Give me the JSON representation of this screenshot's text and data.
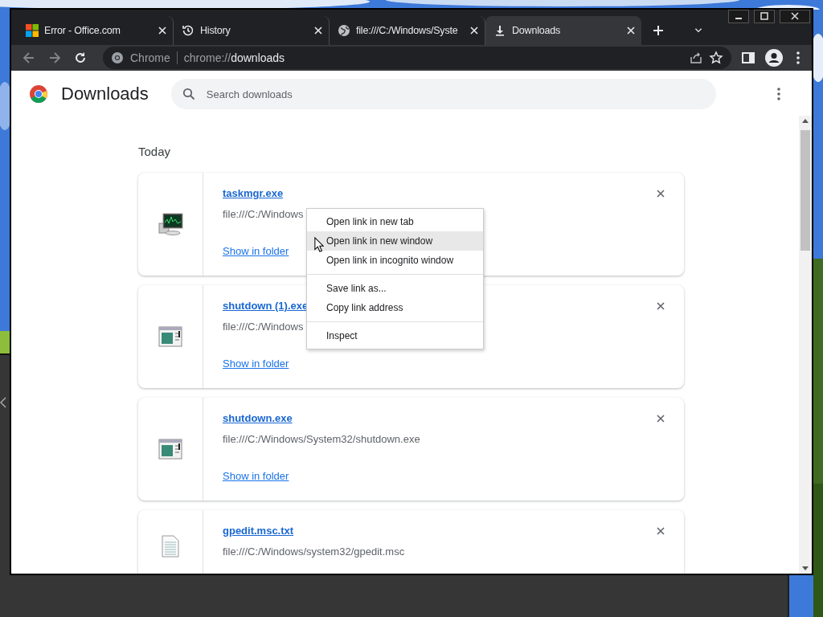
{
  "tabs": [
    {
      "title": "Error - Office.com",
      "selected": false
    },
    {
      "title": "History",
      "selected": false
    },
    {
      "title": "file:///C:/Windows/Syste",
      "selected": false
    },
    {
      "title": "Downloads",
      "selected": true
    }
  ],
  "address_bar": {
    "chip": "Chrome",
    "url_prefix": "chrome://",
    "url_host": "downloads"
  },
  "page": {
    "title": "Downloads",
    "search": {
      "placeholder": "Search downloads"
    },
    "section": "Today"
  },
  "downloads": [
    {
      "name": "taskmgr.exe",
      "path": "file:///C:/Windows",
      "action": "Show in folder"
    },
    {
      "name": "shutdown (1).exe",
      "path": "file:///C:/Windows",
      "action": "Show in folder"
    },
    {
      "name": "shutdown.exe",
      "path": "file:///C:/Windows/System32/shutdown.exe",
      "action": "Show in folder"
    },
    {
      "name": "gpedit.msc.txt",
      "path": "file:///C:/Windows/system32/gpedit.msc"
    }
  ],
  "context_menu": [
    {
      "kind": "item",
      "label": "Open link in new tab",
      "selected": false
    },
    {
      "kind": "item",
      "label": "Open link in new window",
      "selected": true
    },
    {
      "kind": "item",
      "label": "Open link in incognito window",
      "selected": false
    },
    {
      "kind": "separator"
    },
    {
      "kind": "item",
      "label": "Save link as...",
      "selected": false
    },
    {
      "kind": "item",
      "label": "Copy link address",
      "selected": false
    },
    {
      "kind": "separator"
    },
    {
      "kind": "item",
      "label": "Inspect",
      "selected": false
    }
  ]
}
